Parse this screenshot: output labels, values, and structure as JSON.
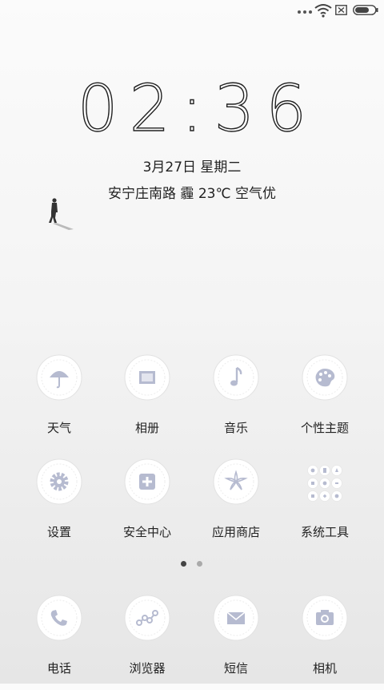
{
  "status": {
    "wifi_icon": "wifi-icon",
    "sim_icon": "sim-disabled-icon",
    "battery_icon": "battery-icon"
  },
  "lock": {
    "time": "02:36",
    "date": "3月27日 星期二",
    "weather": "安宁庄南路 霾 23℃ 空气优"
  },
  "apps": [
    {
      "label": "天气",
      "icon": "umbrella-icon"
    },
    {
      "label": "相册",
      "icon": "picture-frame-icon"
    },
    {
      "label": "音乐",
      "icon": "music-note-icon"
    },
    {
      "label": "个性主题",
      "icon": "palette-icon"
    },
    {
      "label": "设置",
      "icon": "gear-icon"
    },
    {
      "label": "安全中心",
      "icon": "shield-plus-icon"
    },
    {
      "label": "应用商店",
      "icon": "flower-star-icon"
    },
    {
      "label": "系统工具",
      "icon": "tools-grid-icon"
    }
  ],
  "pager": {
    "active": 1,
    "total": 2
  },
  "dock": [
    {
      "label": "电话",
      "icon": "phone-icon"
    },
    {
      "label": "浏览器",
      "icon": "browser-icon"
    },
    {
      "label": "短信",
      "icon": "envelope-icon"
    },
    {
      "label": "相机",
      "icon": "camera-icon"
    }
  ],
  "colors": {
    "icon_glyph": "#b6bbd0",
    "flower": "#ffffff",
    "text": "#222222"
  }
}
